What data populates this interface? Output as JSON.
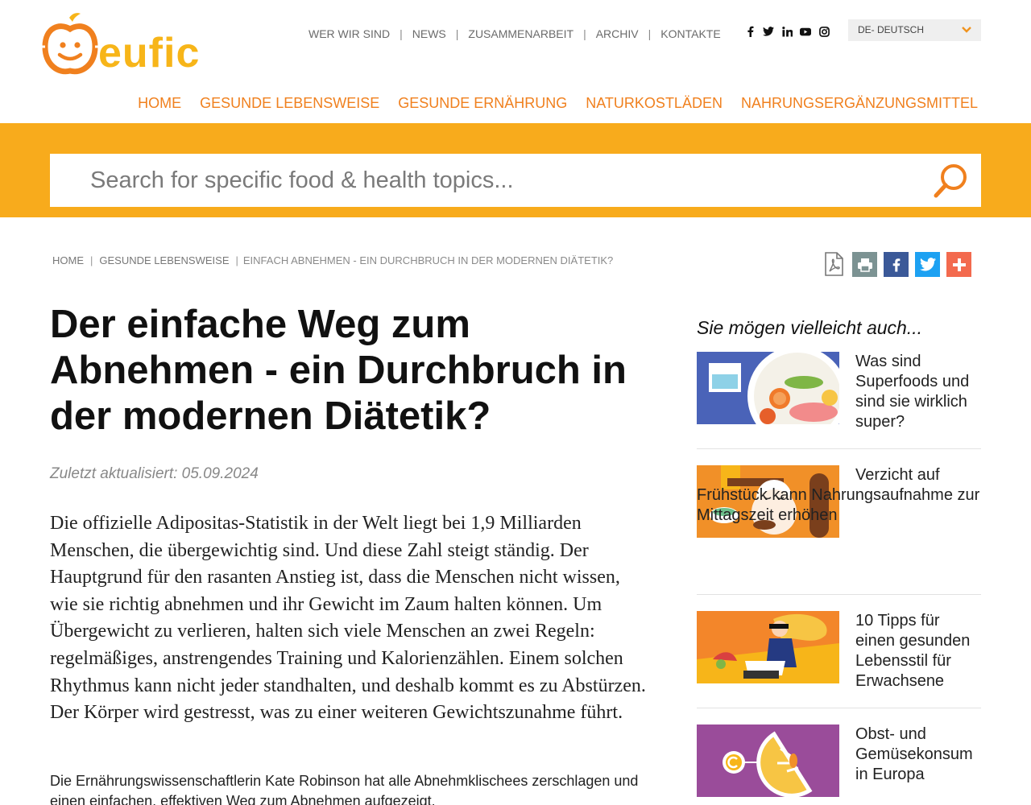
{
  "brand": {
    "name": "eufic",
    "orange": "#f0801e",
    "yellow": "#f8ab1c"
  },
  "topnav": {
    "items": [
      "WER WIR SIND",
      "NEWS",
      "ZUSAMMENARBEIT",
      "ARCHIV",
      "KONTAKTE"
    ],
    "separator": "|"
  },
  "social_top": [
    {
      "icon": "facebook-icon",
      "glyph": "f"
    },
    {
      "icon": "twitter-icon",
      "glyph": "t"
    },
    {
      "icon": "linkedin-icon",
      "glyph": "in"
    },
    {
      "icon": "youtube-icon",
      "glyph": "▶"
    },
    {
      "icon": "instagram-icon",
      "glyph": "◎"
    }
  ],
  "language": {
    "selected": "DE- DEUTSCH"
  },
  "mainnav": {
    "items": [
      "HOME",
      "GESUNDE LEBENSWEISE",
      "GESUNDE ERNÄHRUNG",
      "NATURKOSTLÄDEN",
      "NAHRUNGSERGÄNZUNGSMITTEL"
    ]
  },
  "search": {
    "placeholder": "Search for specific food & health topics..."
  },
  "breadcrumb": {
    "items": [
      "HOME",
      "GESUNDE LEBENSWEISE",
      "EINFACH ABNEHMEN - EIN DURCHBRUCH IN DER MODERNEN DIÄTETIK?"
    ],
    "separator": "|"
  },
  "share": [
    "pdf-icon",
    "print-icon",
    "facebook-icon",
    "twitter-icon",
    "plus-icon"
  ],
  "article": {
    "title": "Der einfache Weg zum Abnehmen - ein Durchbruch in der modernen Diätetik?",
    "updated": "Zuletzt aktualisiert: 05.09.2024",
    "lead": "Die offizielle Adipositas-Statistik in der Welt liegt bei 1,9 Milliarden Menschen, die übergewichtig sind. Und diese Zahl steigt ständig. Der Hauptgrund für den rasanten Anstieg ist, dass die Menschen nicht wissen, wie sie richtig abnehmen und ihr Gewicht im Zaum halten können. Um Übergewicht zu verlieren, halten sich viele Menschen an zwei Regeln: regelmäßiges, anstrengendes Training und Kalorienzählen. Einem solchen Rhythmus kann nicht jeder standhalten, und deshalb kommt es zu Abstürzen. Der Körper wird gestresst, was zu einer weiteren Gewichtszunahme führt.",
    "paragraph": "Die Ernährungswissenschaftlerin Kate Robinson hat alle Abnehmklischees zerschlagen und einen einfachen, effektiven Weg zum Abnehmen aufgezeigt."
  },
  "sidebar": {
    "heading": "Sie mögen vielleicht auch...",
    "cards": [
      {
        "title": "Was sind Superfoods und sind sie wirklich super?"
      },
      {
        "title": "Verzicht auf Frühstück kann Nahrungsaufnahme zur Mittagszeit erhöhen"
      },
      {
        "title": "10 Tipps für einen gesunden Lebensstil für Erwachsene"
      },
      {
        "title": "Obst- und Gemüsekonsum in Europa"
      }
    ]
  }
}
